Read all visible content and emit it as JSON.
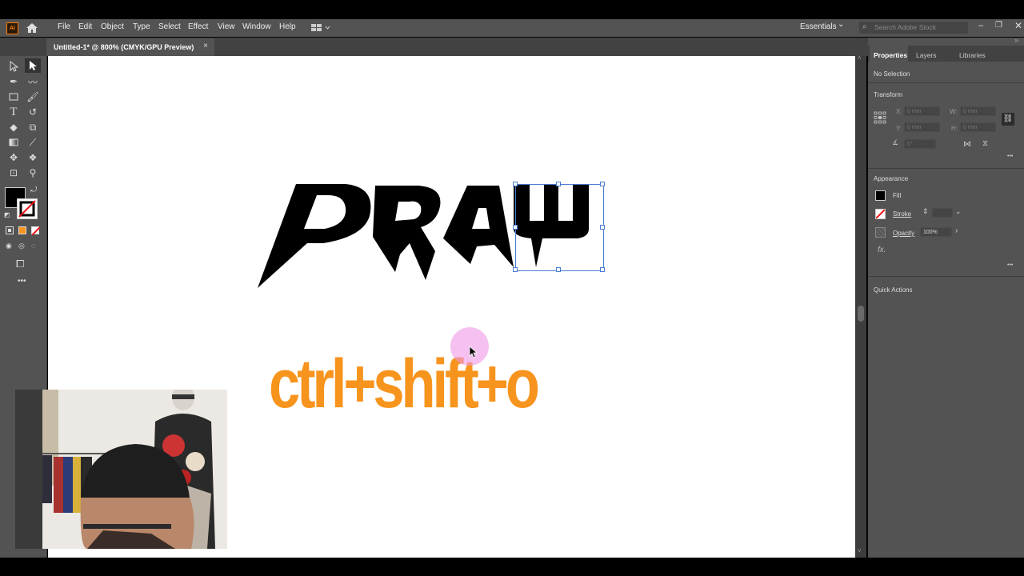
{
  "app": {
    "logo": "Ai",
    "home_icon": "home-icon"
  },
  "menu": [
    "File",
    "Edit",
    "Object",
    "Type",
    "Select",
    "Effect",
    "View",
    "Window",
    "Help"
  ],
  "workspace": {
    "label": "Essentials",
    "chevron": "⌄"
  },
  "search": {
    "placeholder": "Search Adobe Stock"
  },
  "document_tab": {
    "title": "Untitled-1* @ 800% (CMYK/GPU Preview)",
    "close": "×"
  },
  "artwork": {
    "headline": "DRAW",
    "shortcut_text": "ctrl+shift+o",
    "shortcut_color": "#f7941d",
    "headline_color": "#000000"
  },
  "panel": {
    "tabs": [
      "Properties",
      "Layers",
      "Libraries"
    ],
    "selection_status": "No Selection",
    "transform": {
      "title": "Transform",
      "x_label": "X:",
      "x_value": "0 mm",
      "y_label": "Y:",
      "y_value": "0 mm",
      "w_label": "W:",
      "w_value": "0 mm",
      "h_label": "H:",
      "h_value": "0 mm",
      "angle_value": "0°"
    },
    "appearance": {
      "title": "Appearance",
      "fill_label": "Fill",
      "stroke_label": "Stroke",
      "opacity_label": "Opacity",
      "opacity_value": "100%",
      "fx_label": "fx."
    },
    "quick_actions": {
      "title": "Quick Actions"
    },
    "more": "•••"
  },
  "colors": {
    "accent": "#4a7bd4",
    "ui_dark": "#535353",
    "orange": "#f7941d"
  }
}
